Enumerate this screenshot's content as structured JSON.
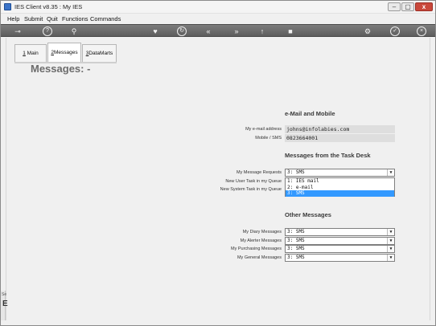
{
  "window": {
    "title": "IES Client v8.35 : My IES",
    "close_glyph": "x",
    "min_glyph": "–",
    "max_glyph": "▢"
  },
  "menu": [
    "Help",
    "Submit",
    "Quit",
    "Functions",
    "Commands"
  ],
  "toolbar_icons": [
    "key-icon",
    "help-icon",
    "search-icon",
    "heart-icon",
    "refresh-icon",
    "rewind-icon",
    "fast-forward-icon",
    "upload-icon",
    "stop-icon",
    "gear-icon",
    "check-icon",
    "close-icon"
  ],
  "tabs": [
    {
      "key": "1",
      "label": "Main"
    },
    {
      "key": "2",
      "label": "Messages"
    },
    {
      "key": "3",
      "label": "DataMarts"
    }
  ],
  "page_title": "Messages: -",
  "email_section": {
    "heading": "e-Mail and Mobile",
    "email_label": "My e-mail address",
    "email_value": "johns@infolabies.com",
    "mobile_label": "Mobile / SMS",
    "mobile_value": "0823664001"
  },
  "task_section": {
    "heading": "Messages from the Task Desk",
    "rows": [
      {
        "label": "My Message Requests",
        "value": "3: SMS"
      },
      {
        "label": "New User Task in my Queue",
        "value": ""
      },
      {
        "label": "New System Task in my Queue",
        "value": ""
      }
    ],
    "dropdown_options": [
      "1: IES mail",
      "2: e-mail",
      "3: SMS"
    ],
    "dropdown_selected_index": 2
  },
  "other_section": {
    "heading": "Other Messages",
    "rows": [
      {
        "label": "My Diary Messages",
        "value": "3: SMS"
      },
      {
        "label": "My Alerter Messages",
        "value": "3: SMS"
      },
      {
        "label": "My Purchasing Messages",
        "value": "3: SMS"
      },
      {
        "label": "My General Messages",
        "value": "3: SMS"
      }
    ]
  },
  "side_stub": {
    "text": "Se",
    "big": "E"
  }
}
